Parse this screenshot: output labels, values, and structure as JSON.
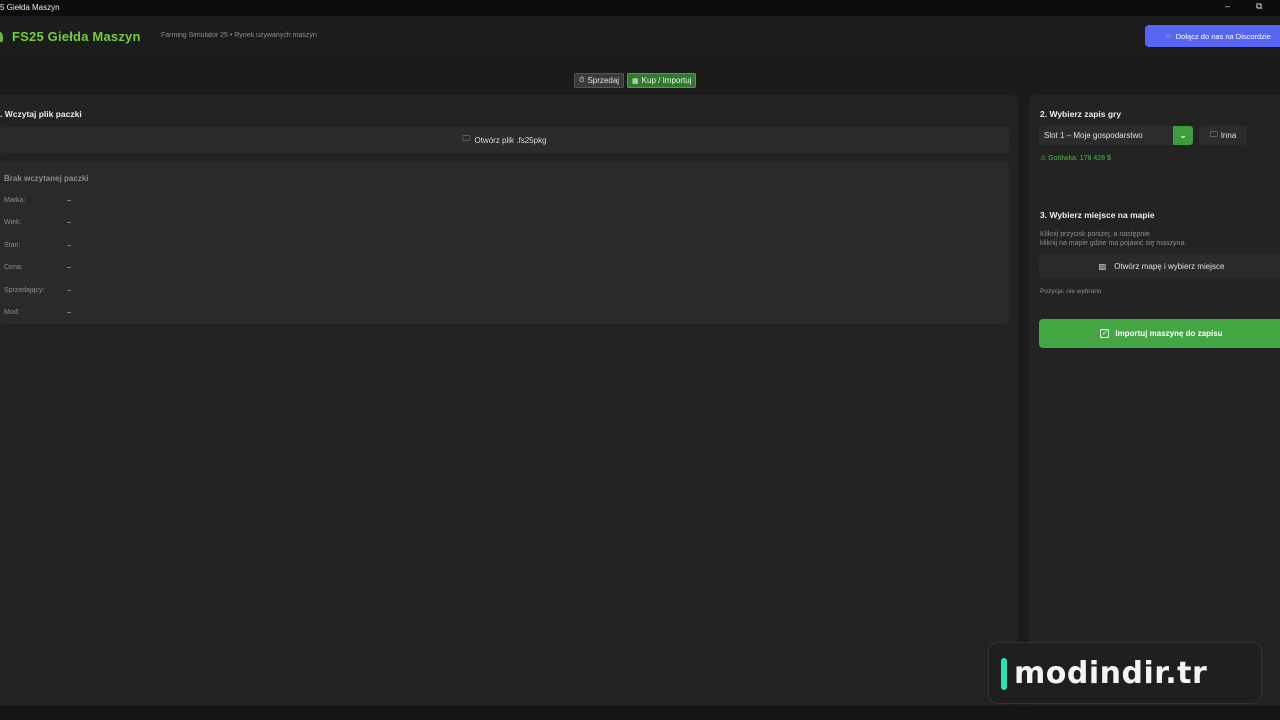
{
  "window": {
    "title": "5 Giełda Maszyn",
    "minimize_glyph": "–",
    "maximize_glyph": "⧉"
  },
  "header": {
    "app_title": "FS25 Giełda Maszyn",
    "subtitle": "Farming Simulator 25 • Rynek używanych maszyn",
    "discord_button": "Dołącz do nas na Discordzie"
  },
  "tabs": [
    {
      "icon": "⏱",
      "label": "Sprzedaj",
      "active": false
    },
    {
      "icon": "▦",
      "label": "Kup / Importuj",
      "active": true
    }
  ],
  "left": {
    "section_title": ". Wczytaj plik paczki",
    "open_file_label": "Otwórz plik .fs25pkg",
    "info_title": "Brak wczytanej paczki",
    "rows": [
      {
        "label": "Marka:",
        "value": "–"
      },
      {
        "label": "Wiek:",
        "value": "–"
      },
      {
        "label": "Stan:",
        "value": "–"
      },
      {
        "label": "Cena:",
        "value": "–"
      },
      {
        "label": "Sprzedający:",
        "value": "–"
      },
      {
        "label": "Mod:",
        "value": "–"
      }
    ]
  },
  "right": {
    "save_title": "2. Wybierz zapis gry",
    "slot_value": "Slot 1 – Moje gospodarstwo",
    "other_button": "Inna",
    "cash": "Gotówka: 178 428 $",
    "map_title": "3. Wybierz miejsce na mapie",
    "hint_line1": "Kliknij przycisk poniżej, a następnie",
    "hint_line2": "kliknij na mapie gdzie ma pojawić się maszyna.",
    "map_button": "Otwórz mapę i wybierz miejsce",
    "position": "Pozycja: nie wybrano",
    "import_button": "Importuj maszynę do zapisu"
  },
  "watermark": {
    "text": "modindir.tr"
  },
  "colors": {
    "brand_green": "#6fcf3f",
    "accent_green": "#43a643",
    "discord": "#5865f2",
    "watermark_accent": "#2fe0b6"
  }
}
